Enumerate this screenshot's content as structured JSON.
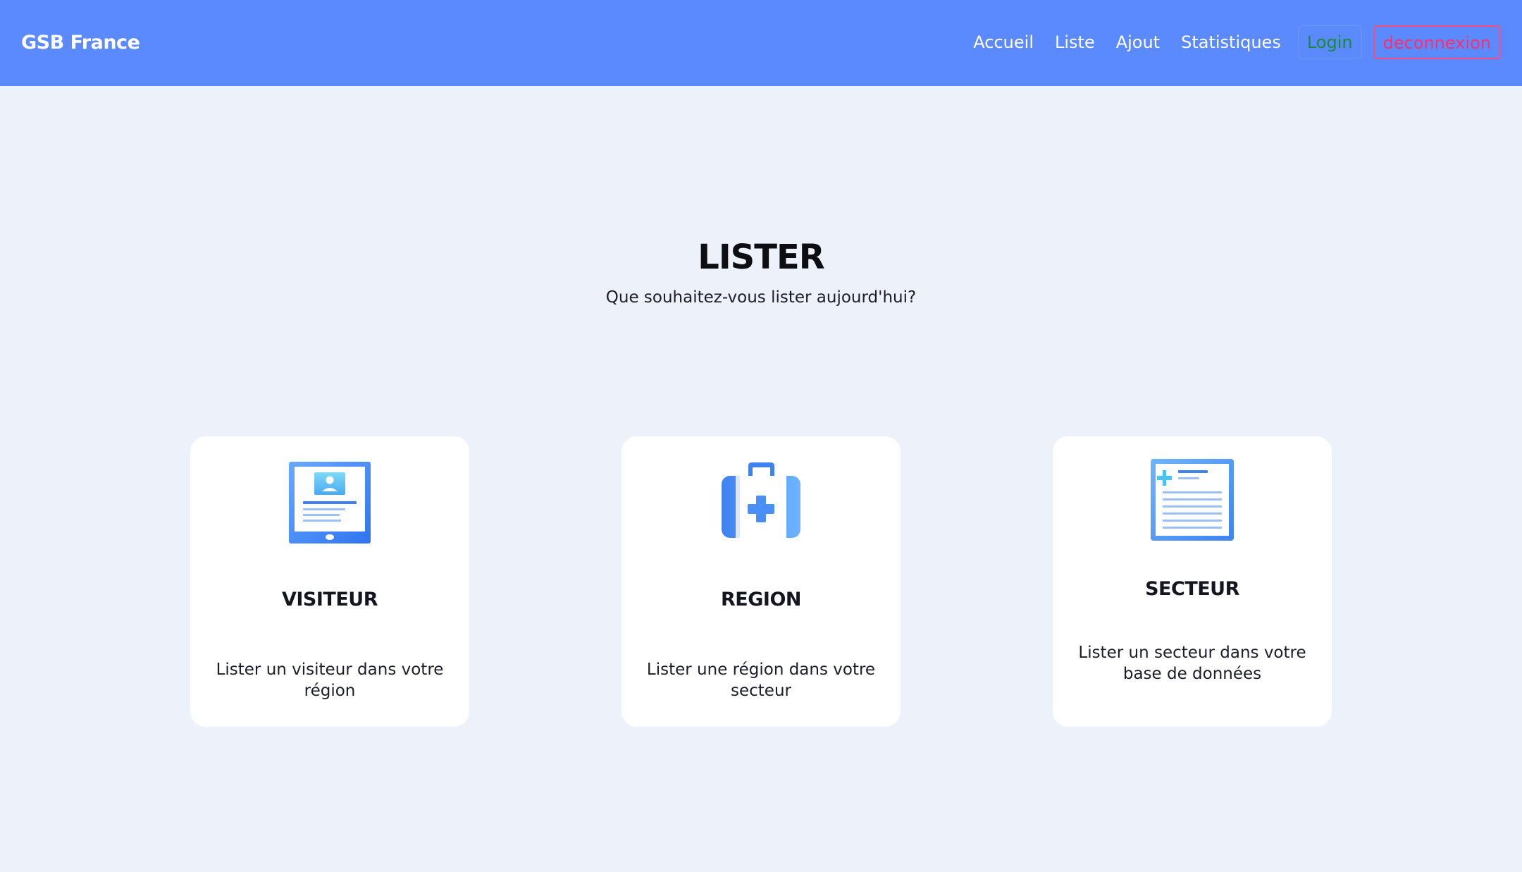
{
  "navbar": {
    "brand": "GSB France",
    "links": [
      "Accueil",
      "Liste",
      "Ajout",
      "Statistiques"
    ],
    "login_label": "Login",
    "logout_label": "deconnexion",
    "colors": {
      "background": "#5a8afe",
      "login": "#1a8a3a",
      "logout": "#ff2d6f"
    }
  },
  "main": {
    "title": "LISTER",
    "subtitle": "Que souhaitez-vous lister aujourd'hui?",
    "cards": [
      {
        "icon": "tablet-profile-icon",
        "title": "VISITEUR",
        "description": "Lister un visiteur dans votre région"
      },
      {
        "icon": "medical-kit-icon",
        "title": "REGION",
        "description": "Lister une région dans votre secteur"
      },
      {
        "icon": "medical-document-icon",
        "title": "SECTEUR",
        "description": "Lister un secteur dans votre base de données"
      }
    ]
  }
}
